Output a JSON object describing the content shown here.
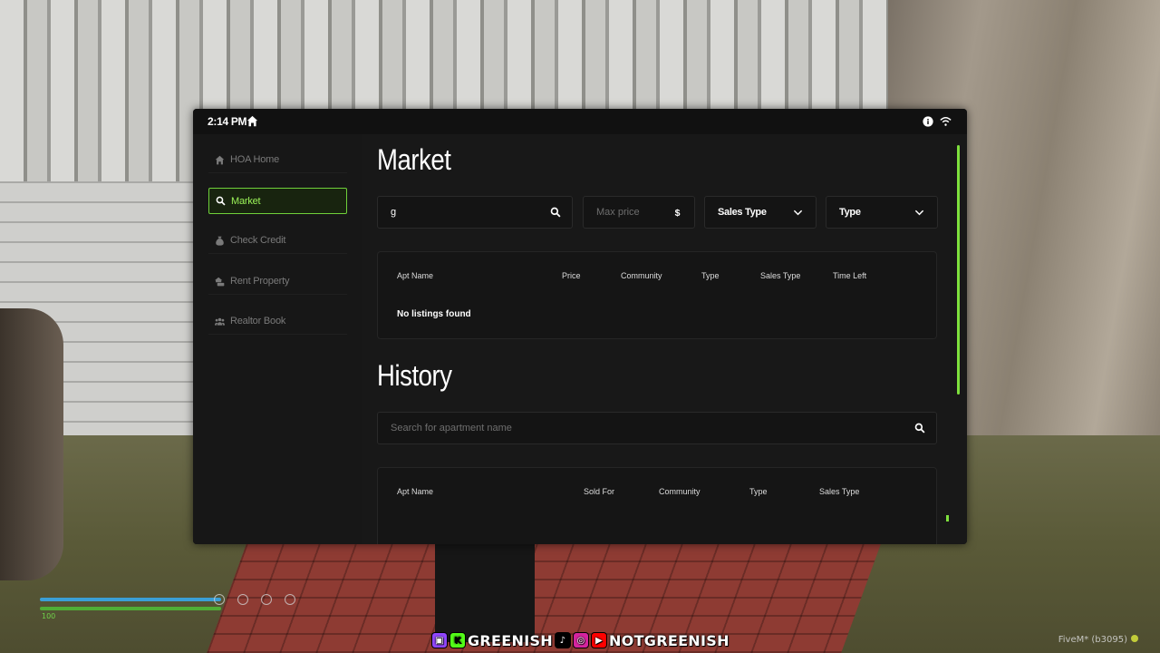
{
  "status_bar": {
    "time": "2:14 PM"
  },
  "sidebar": {
    "items": [
      {
        "label": "HOA Home",
        "icon": "home-icon",
        "active": false
      },
      {
        "label": "Market",
        "icon": "search-icon",
        "active": true
      },
      {
        "label": "Check Credit",
        "icon": "money-bag-icon",
        "active": false
      },
      {
        "label": "Rent Property",
        "icon": "rent-house-icon",
        "active": false
      },
      {
        "label": "Realtor Book",
        "icon": "users-icon",
        "active": false
      }
    ]
  },
  "market": {
    "title": "Market",
    "search_value": "g",
    "max_price_placeholder": "Max price",
    "sales_type_label": "Sales Type",
    "type_label": "Type",
    "columns": [
      "Apt Name",
      "Price",
      "Community",
      "Type",
      "Sales Type",
      "Time Left"
    ],
    "empty_message": "No listings found"
  },
  "history": {
    "title": "History",
    "search_placeholder": "Search for apartment name",
    "columns": [
      "Apt Name",
      "Sold For",
      "Community",
      "Type",
      "Sales Type"
    ]
  },
  "hud": {
    "value": "100"
  },
  "social_banner": {
    "handle_1": "GREENISH",
    "handle_2": "NOTGREENISH"
  },
  "client_tag": "FiveM* (b3095)",
  "colors": {
    "accent": "#7ee03d",
    "panel": "#181818",
    "sidebar": "#171717"
  }
}
